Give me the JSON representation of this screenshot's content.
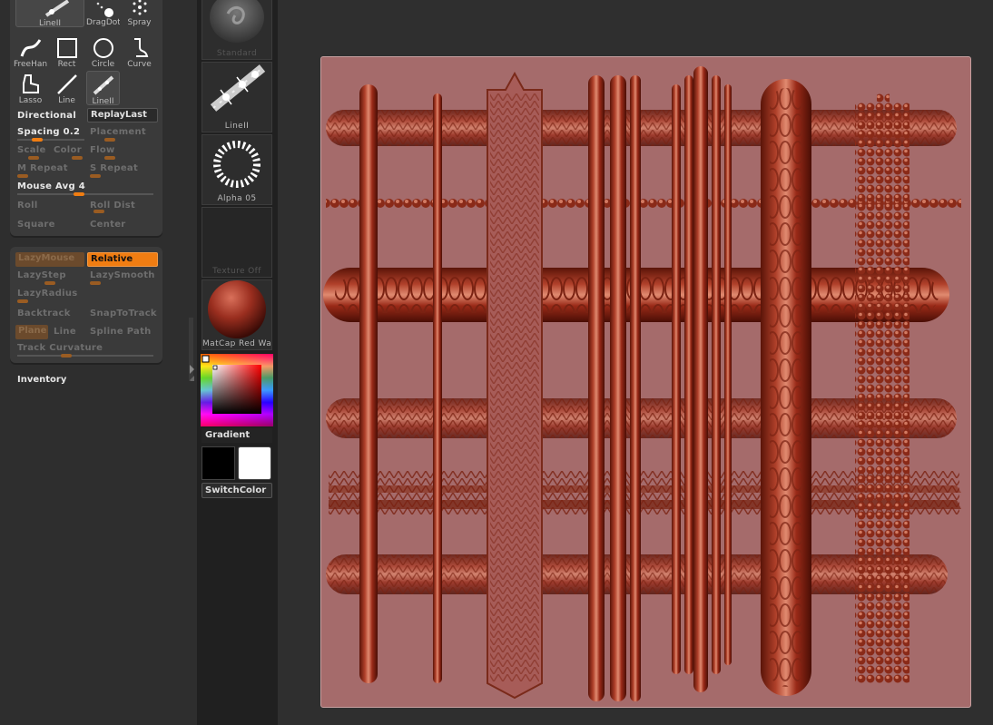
{
  "stroke_panel": {
    "strokes": [
      {
        "label": "LineII",
        "icon": "stroke-line2-icon"
      },
      {
        "label": "DragDot",
        "icon": "dragdot-icon"
      },
      {
        "label": "Spray",
        "icon": "spray-icon"
      },
      {
        "label": "FreeHand",
        "icon": "freehand-icon"
      },
      {
        "label": "Rect",
        "icon": "rect-icon"
      },
      {
        "label": "Circle",
        "icon": "circle-icon"
      },
      {
        "label": "Curve",
        "icon": "curve-icon"
      },
      {
        "label": "Lasso",
        "icon": "lasso-icon"
      },
      {
        "label": "Line",
        "icon": "line-icon"
      },
      {
        "label": "LineII",
        "icon": "stroke-line2-icon"
      }
    ],
    "directional": "Directional",
    "replay_last": "ReplayLast",
    "spacing_label": "Spacing 0.2",
    "placement_label": "Placement",
    "scale_label": "Scale",
    "color_label": "Color",
    "flow_label": "Flow",
    "m_repeat_label": "M Repeat",
    "s_repeat_label": "S Repeat",
    "mouse_avg_label": "Mouse Avg 4",
    "roll_label": "Roll",
    "roll_dist_label": "Roll Dist",
    "square_label": "Square",
    "center_label": "Center"
  },
  "lazy_panel": {
    "lazymouse": "LazyMouse",
    "relative": "Relative",
    "lazystep": "LazyStep",
    "lazysmooth": "LazySmooth",
    "lazyradius": "LazyRadius",
    "backtrack": "Backtrack",
    "snaptotrack": "SnapToTrack",
    "plane": "Plane",
    "line": "Line",
    "spline_path": "Spline Path",
    "track_curvature": "Track Curvature"
  },
  "inventory": {
    "title": "Inventory"
  },
  "shelf": {
    "brush_label": "Standard",
    "stroke_label": "LineII",
    "alpha_label": "Alpha 05",
    "texture_label": "Texture Off",
    "material_label": "MatCap Red Wax",
    "gradient_label": "Gradient",
    "switch_color_label": "SwitchColor",
    "main_color": "#000000",
    "secondary_color": "#ffffff",
    "accent_color": "#f07d12"
  }
}
